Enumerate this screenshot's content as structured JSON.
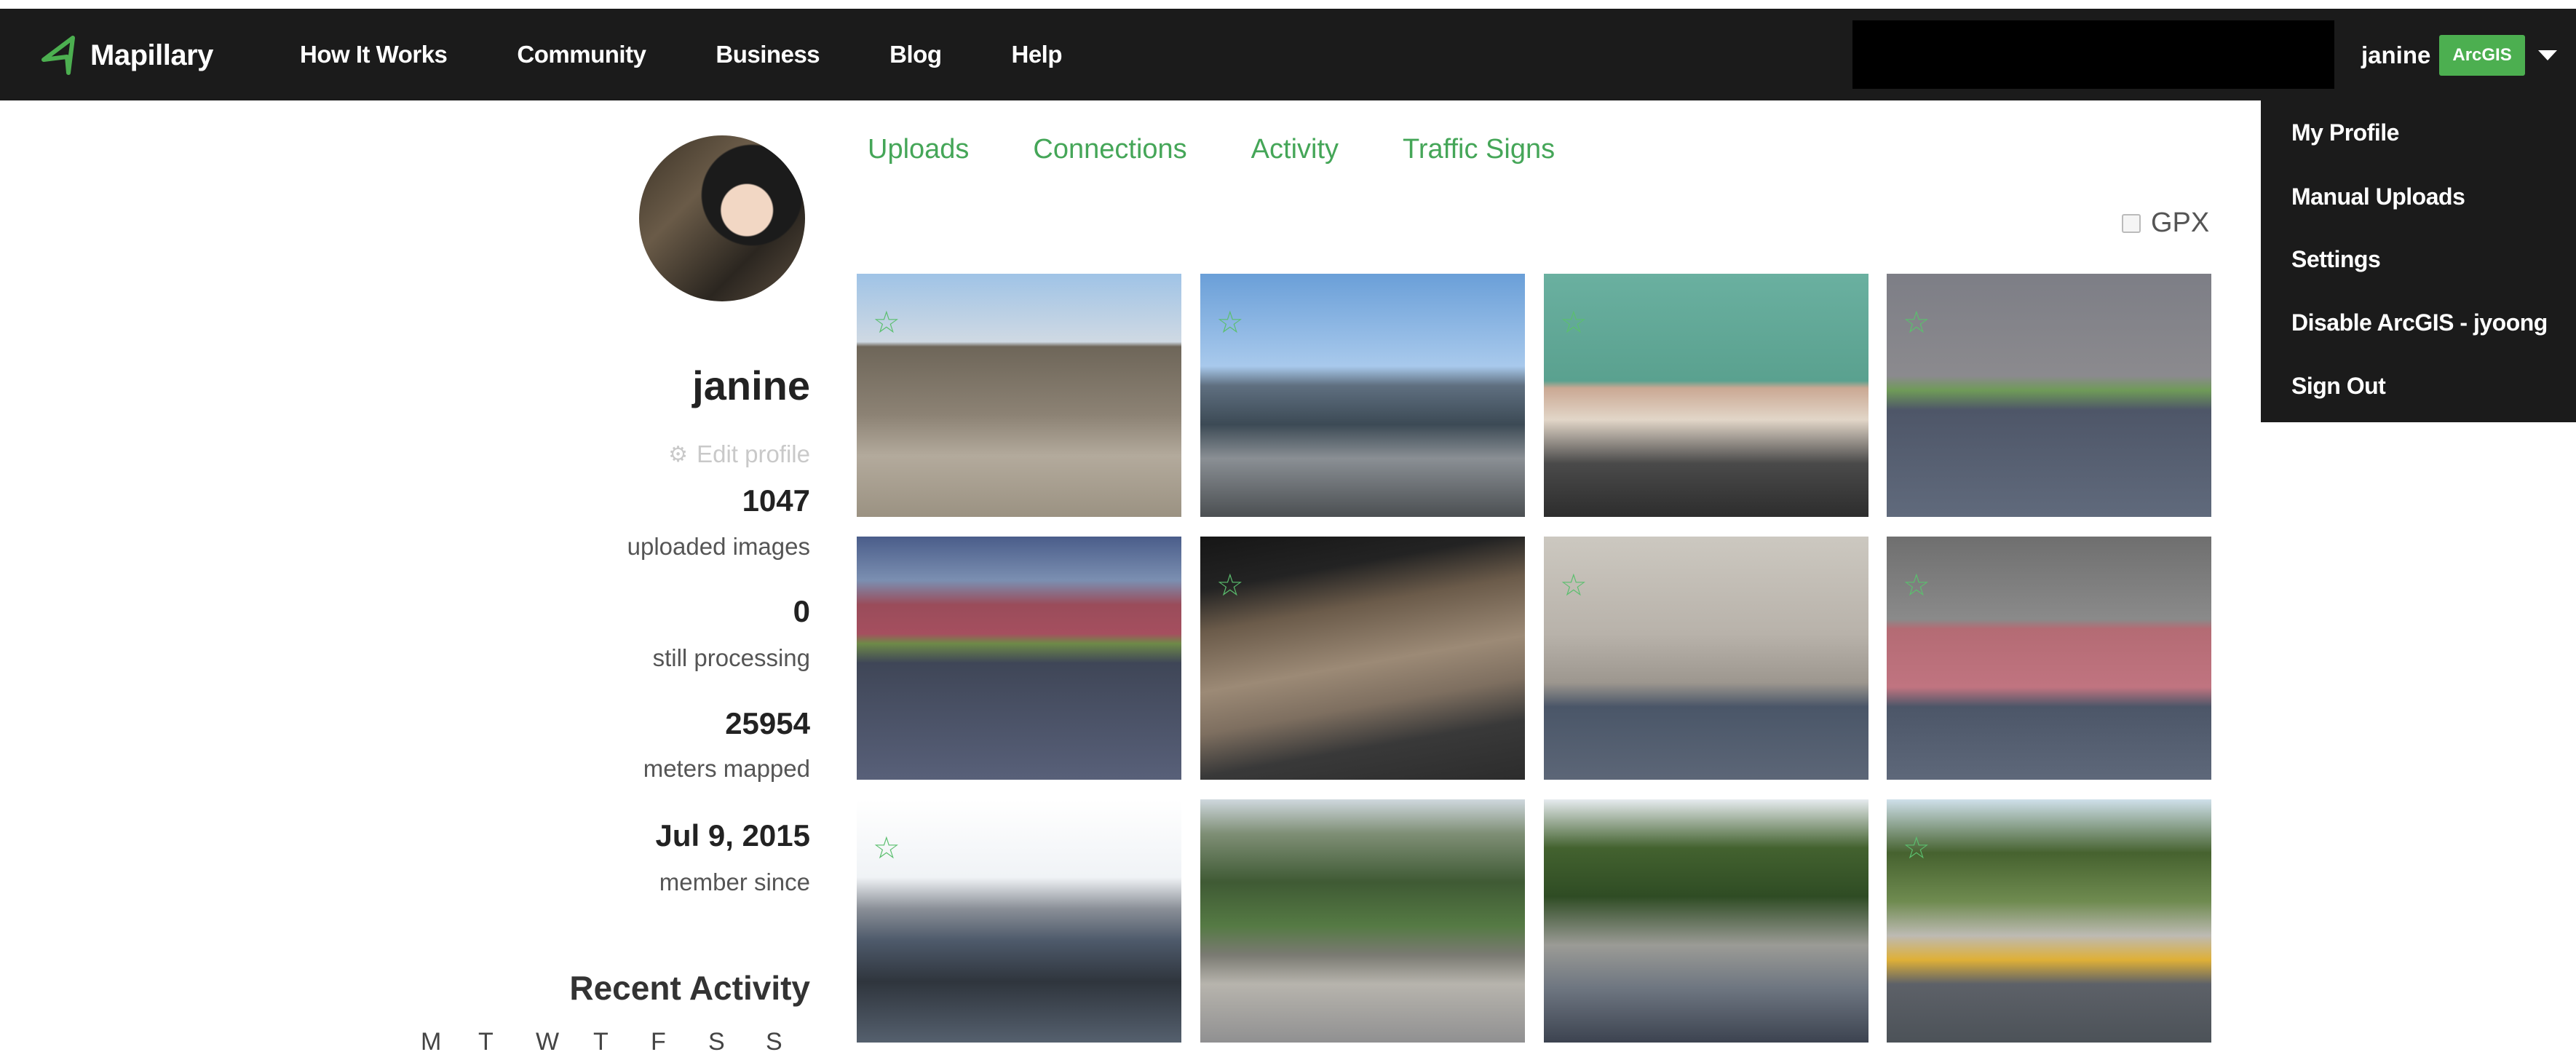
{
  "navbar": {
    "brand": "Mapillary",
    "links": [
      "How It Works",
      "Community",
      "Business",
      "Blog",
      "Help"
    ],
    "username": "janine",
    "badge": "ArcGIS"
  },
  "dropdown": {
    "items": [
      "My Profile",
      "Manual Uploads",
      "Settings",
      "Disable ArcGIS - jyoong",
      "Sign Out"
    ]
  },
  "profile": {
    "username": "janine",
    "edit_label": "Edit profile",
    "stats": [
      {
        "value": "1047",
        "label": "uploaded images"
      },
      {
        "value": "0",
        "label": "still processing"
      },
      {
        "value": "25954",
        "label": "meters mapped"
      },
      {
        "value": "Jul 9, 2015",
        "label": "member since"
      }
    ],
    "recent_activity_title": "Recent Activity",
    "weekdays": [
      "M",
      "T",
      "W",
      "T",
      "F",
      "S",
      "S"
    ]
  },
  "tabs": [
    "Uploads",
    "Connections",
    "Activity",
    "Traffic Signs"
  ],
  "gpx_label": "GPX",
  "thumbnails": {
    "starred": [
      true,
      true,
      true,
      true,
      false,
      true,
      true,
      true,
      true,
      false,
      false,
      true
    ]
  },
  "colors": {
    "navbar_bg": "#1b1b1b",
    "accent_green": "#45a658",
    "badge_green": "#4caf50"
  },
  "icons": {
    "logo": "mapillary-logo-icon",
    "caret": "chevron-down-icon",
    "edit": "cog-icon",
    "star": "star-icon"
  }
}
